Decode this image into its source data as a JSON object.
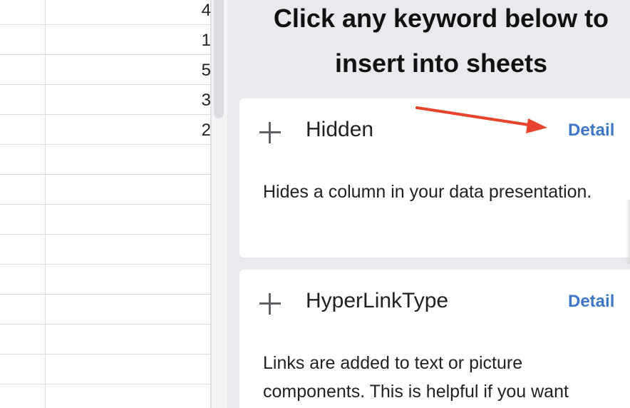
{
  "sheet": {
    "visible_values": [
      "4",
      "1",
      "5",
      "3",
      "2"
    ]
  },
  "panel": {
    "title_line1": "Click any keyword below to",
    "title_line2": "insert into sheets",
    "keywords": [
      {
        "name": "Hidden",
        "detail_label": "Detail",
        "description": "Hides a column in your data presentation."
      },
      {
        "name": "HyperLinkType",
        "detail_label": "Detail",
        "description": "Links are added to text or picture components. This is helpful if you want"
      }
    ]
  },
  "colors": {
    "detail_link": "#3c78c6",
    "annotation_arrow": "#e8432d",
    "panel_background": "#e8eaed"
  }
}
